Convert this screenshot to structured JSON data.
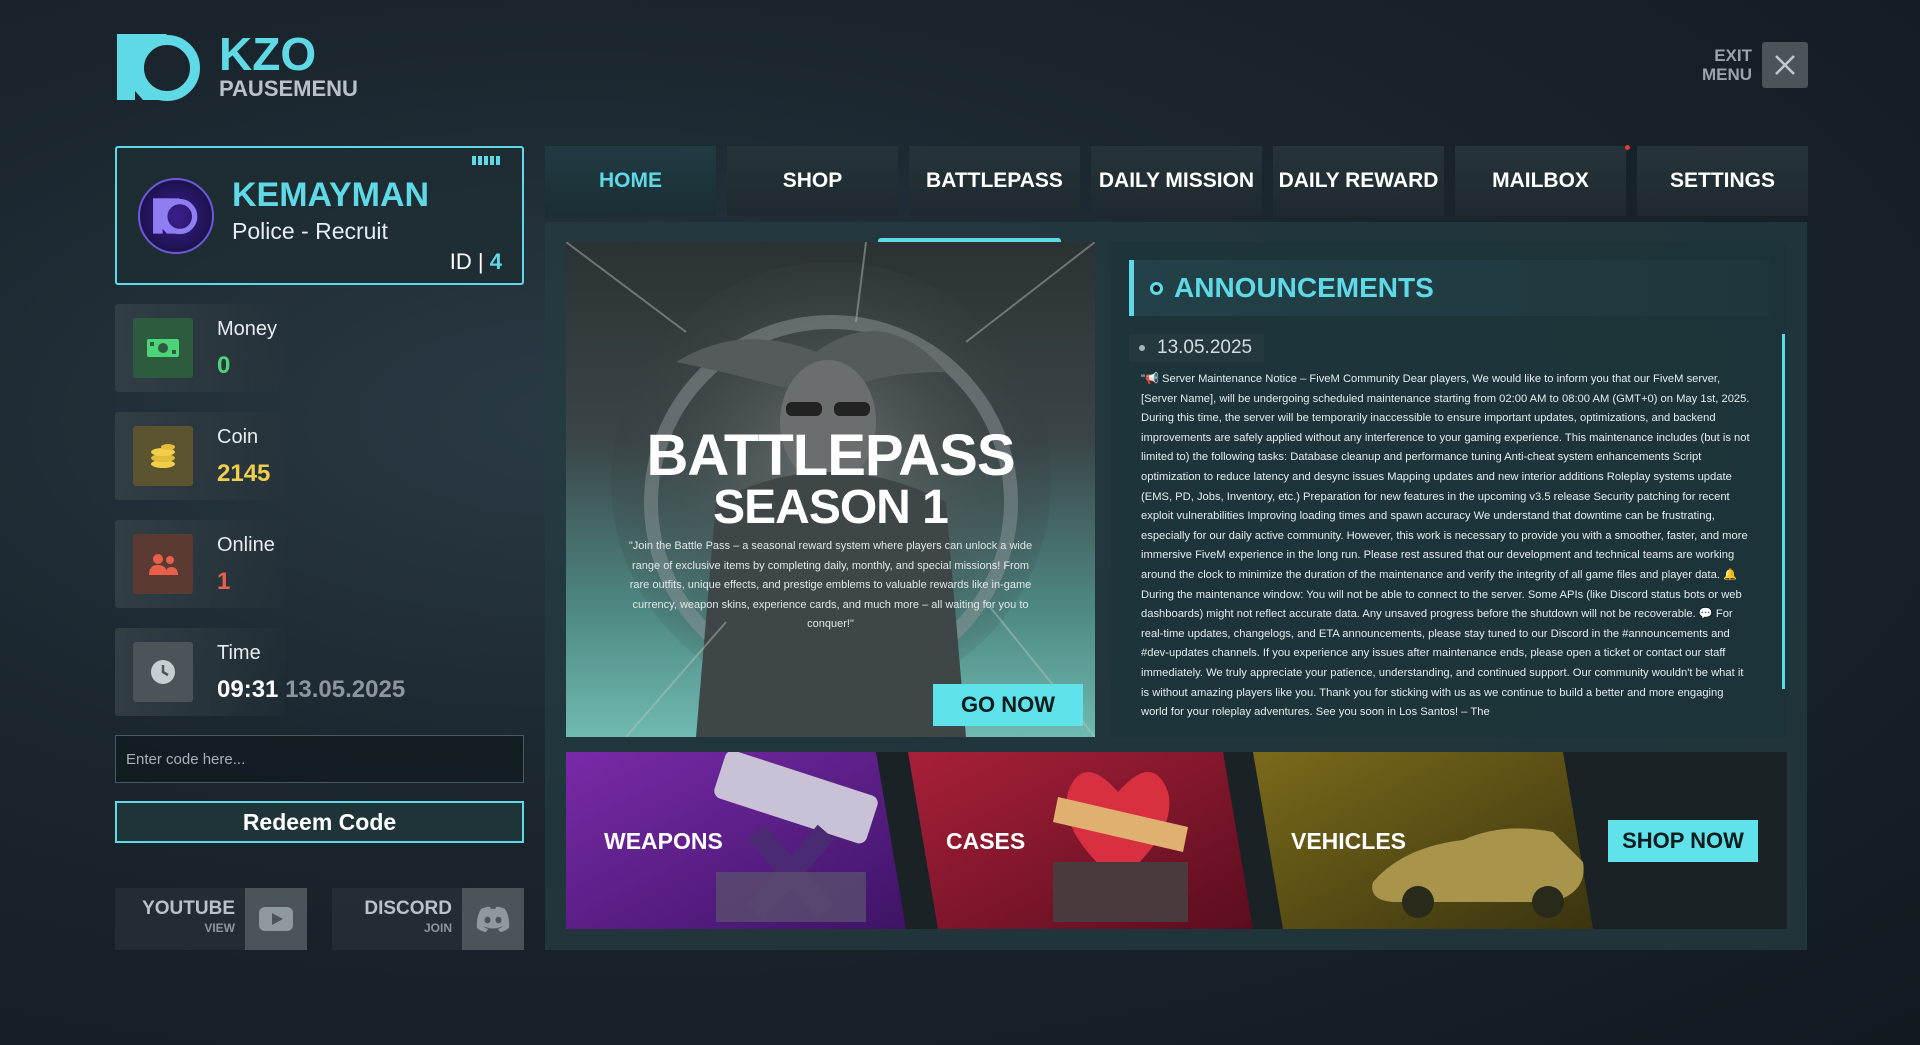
{
  "brand": {
    "title": "KZO",
    "subtitle": "PAUSEMENU"
  },
  "exit": {
    "line1": "EXIT",
    "line2": "MENU"
  },
  "profile": {
    "name": "KEMAYMAN",
    "role": "Police - Recruit",
    "id_label": "ID |",
    "id_value": "4"
  },
  "stats": {
    "money": {
      "label": "Money",
      "value": "0"
    },
    "coin": {
      "label": "Coin",
      "value": "2145"
    },
    "online": {
      "label": "Online",
      "value": "1"
    },
    "time": {
      "label": "Time",
      "value": "09:31",
      "date": "13.05.2025"
    }
  },
  "redeem": {
    "placeholder": "Enter code here...",
    "button": "Redeem Code"
  },
  "social": {
    "youtube": {
      "name": "YOUTUBE",
      "action": "VIEW"
    },
    "discord": {
      "name": "DISCORD",
      "action": "JOIN"
    }
  },
  "nav": [
    "HOME",
    "SHOP",
    "BATTLEPASS",
    "DAILY MISSION",
    "DAILY REWARD",
    "MAILBOX",
    "SETTINGS"
  ],
  "battlepass": {
    "title1": "BATTLEPASS",
    "title2": "SEASON 1",
    "description": "\"Join the Battle Pass – a seasonal reward system where players can unlock a wide range of exclusive items by completing daily, monthly, and special missions! From rare outfits, unique effects, and prestige emblems to valuable rewards like in-game currency, weapon skins, experience cards, and much more – all waiting for you to conquer!\"",
    "button": "GO NOW"
  },
  "announcements": {
    "title": "ANNOUNCEMENTS",
    "date": "13.05.2025",
    "body": "\"📢 Server Maintenance Notice – FiveM Community Dear players, We would like to inform you that our FiveM server, [Server Name], will be undergoing scheduled maintenance starting from 02:00 AM to 08:00 AM (GMT+0) on May 1st, 2025. During this time, the server will be temporarily inaccessible to ensure important updates, optimizations, and backend improvements are safely applied without any interference to your gaming experience. This maintenance includes (but is not limited to) the following tasks: Database cleanup and performance tuning Anti-cheat system enhancements Script optimization to reduce latency and desync issues Mapping updates and new interior additions Roleplay systems update (EMS, PD, Jobs, Inventory, etc.) Preparation for new features in the upcoming v3.5 release Security patching for recent exploit vulnerabilities Improving loading times and spawn accuracy We understand that downtime can be frustrating, especially for our daily active community. However, this work is necessary to provide you with a smoother, faster, and more immersive FiveM experience in the long run. Please rest assured that our development and technical teams are working around the clock to minimize the duration of the maintenance and verify the integrity of all game files and player data. 🔔 During the maintenance window: You will not be able to connect to the server. Some APIs (like Discord status bots or web dashboards) might not reflect accurate data. Any unsaved progress before the shutdown will not be recoverable. 💬 For real-time updates, changelogs, and ETA announcements, please stay tuned to our Discord in the #announcements and #dev-updates channels. If you experience any issues after maintenance ends, please open a ticket or contact our staff immediately. We truly appreciate your patience, understanding, and continued support. Our community wouldn't be what it is without amazing players like you. Thank you for sticking with us as we continue to build a better and more engaging world for your roleplay adventures. See you soon in Los Santos! – The"
  },
  "categories": [
    "WEAPONS",
    "CASES",
    "VEHICLES"
  ],
  "shop_button": "SHOP NOW",
  "colors": {
    "accent": "#5fd9e6",
    "money": "#4cd47a",
    "coin": "#f2cf4a",
    "online": "#e8604a",
    "bg": "#1a252d"
  }
}
